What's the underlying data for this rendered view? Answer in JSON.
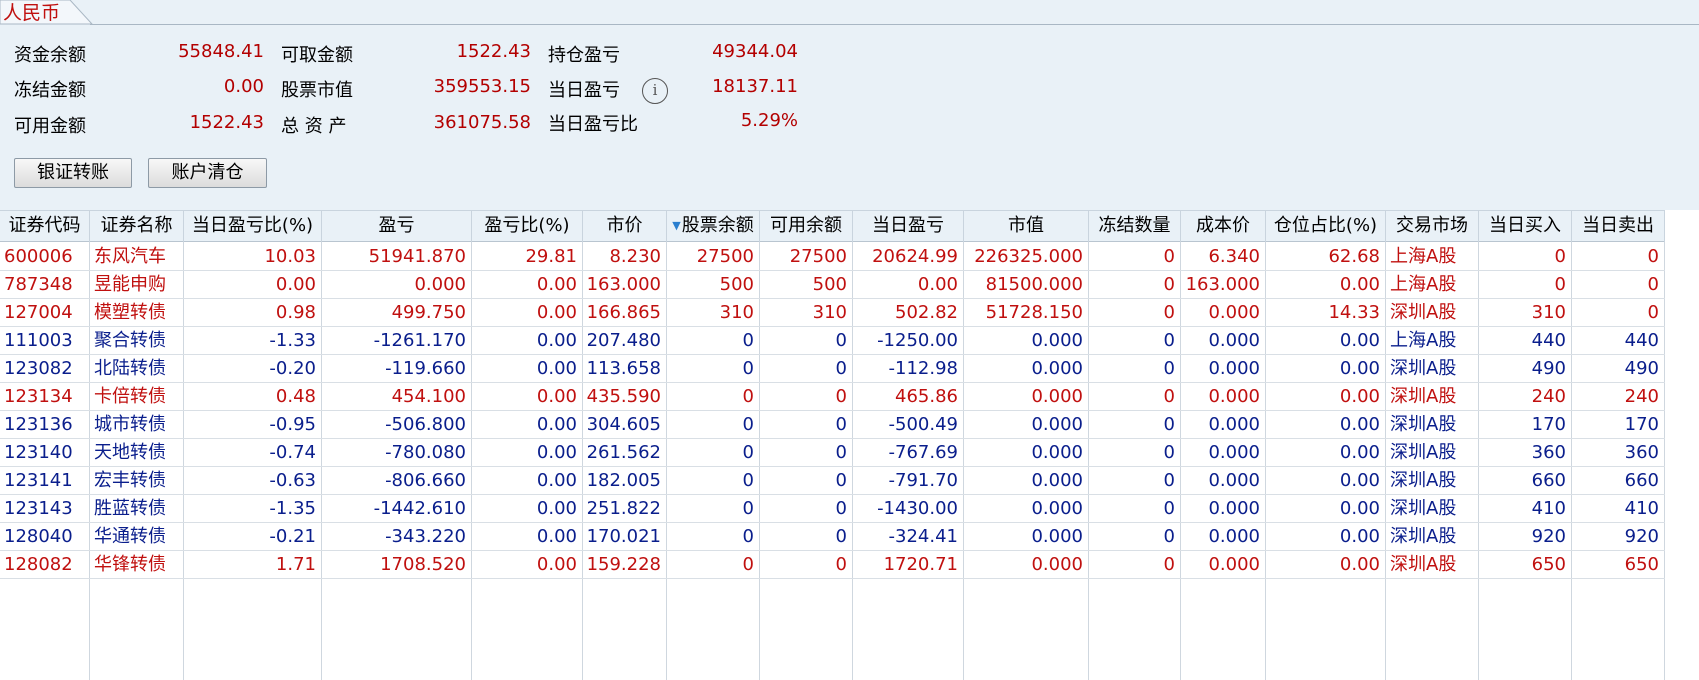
{
  "tab": {
    "label": "人民币"
  },
  "summary": {
    "fund_balance_label": "资金余额",
    "fund_balance": "55848.41",
    "withdrawable_label": "可取金额",
    "withdrawable": "1522.43",
    "position_pnl_label": "持仓盈亏",
    "position_pnl": "49344.04",
    "frozen_label": "冻结金额",
    "frozen": "0.00",
    "stock_value_label": "股票市值",
    "stock_value": "359553.15",
    "today_pnl_label": "当日盈亏",
    "today_pnl": "18137.11",
    "available_label": "可用金额",
    "available": "1522.43",
    "total_assets_label": "总 资 产",
    "total_assets": "361075.58",
    "today_pnl_ratio_label": "当日盈亏比",
    "today_pnl_ratio": "5.29%"
  },
  "buttons": {
    "bank_transfer": "银证转账",
    "clear_account": "账户清仓"
  },
  "colors": {
    "red": "#c0100f",
    "blue": "#0a1e8c"
  },
  "table": {
    "columns": [
      "证券代码",
      "证券名称",
      "当日盈亏比(%)",
      "盈亏",
      "盈亏比(%)",
      "市价",
      "股票余额",
      "可用余额",
      "当日盈亏",
      "市值",
      "冻结数量",
      "成本价",
      "仓位占比(%)",
      "交易市场",
      "当日买入",
      "当日卖出"
    ],
    "rows": [
      {
        "color": "red",
        "cells": [
          "600006",
          "东风汽车",
          "10.03",
          "51941.870",
          "29.81",
          "8.230",
          "27500",
          "27500",
          "20624.99",
          "226325.000",
          "0",
          "6.340",
          "62.68",
          "上海A股",
          "0",
          "0"
        ]
      },
      {
        "color": "red",
        "cells": [
          "787348",
          "昱能申购",
          "0.00",
          "0.000",
          "0.00",
          "163.000",
          "500",
          "500",
          "0.00",
          "81500.000",
          "0",
          "163.000",
          "0.00",
          "上海A股",
          "0",
          "0"
        ]
      },
      {
        "color": "red",
        "cells": [
          "127004",
          "模塑转债",
          "0.98",
          "499.750",
          "0.00",
          "166.865",
          "310",
          "310",
          "502.82",
          "51728.150",
          "0",
          "0.000",
          "14.33",
          "深圳A股",
          "310",
          "0"
        ]
      },
      {
        "color": "blue",
        "cells": [
          "111003",
          "聚合转债",
          "-1.33",
          "-1261.170",
          "0.00",
          "207.480",
          "0",
          "0",
          "-1250.00",
          "0.000",
          "0",
          "0.000",
          "0.00",
          "上海A股",
          "440",
          "440"
        ]
      },
      {
        "color": "blue",
        "cells": [
          "123082",
          "北陆转债",
          "-0.20",
          "-119.660",
          "0.00",
          "113.658",
          "0",
          "0",
          "-112.98",
          "0.000",
          "0",
          "0.000",
          "0.00",
          "深圳A股",
          "490",
          "490"
        ]
      },
      {
        "color": "red",
        "cells": [
          "123134",
          "卡倍转债",
          "0.48",
          "454.100",
          "0.00",
          "435.590",
          "0",
          "0",
          "465.86",
          "0.000",
          "0",
          "0.000",
          "0.00",
          "深圳A股",
          "240",
          "240"
        ]
      },
      {
        "color": "blue",
        "cells": [
          "123136",
          "城市转债",
          "-0.95",
          "-506.800",
          "0.00",
          "304.605",
          "0",
          "0",
          "-500.49",
          "0.000",
          "0",
          "0.000",
          "0.00",
          "深圳A股",
          "170",
          "170"
        ]
      },
      {
        "color": "blue",
        "cells": [
          "123140",
          "天地转债",
          "-0.74",
          "-780.080",
          "0.00",
          "261.562",
          "0",
          "0",
          "-767.69",
          "0.000",
          "0",
          "0.000",
          "0.00",
          "深圳A股",
          "360",
          "360"
        ]
      },
      {
        "color": "blue",
        "cells": [
          "123141",
          "宏丰转债",
          "-0.63",
          "-806.660",
          "0.00",
          "182.005",
          "0",
          "0",
          "-791.70",
          "0.000",
          "0",
          "0.000",
          "0.00",
          "深圳A股",
          "660",
          "660"
        ]
      },
      {
        "color": "blue",
        "cells": [
          "123143",
          "胜蓝转债",
          "-1.35",
          "-1442.610",
          "0.00",
          "251.822",
          "0",
          "0",
          "-1430.00",
          "0.000",
          "0",
          "0.000",
          "0.00",
          "深圳A股",
          "410",
          "410"
        ]
      },
      {
        "color": "blue",
        "cells": [
          "128040",
          "华通转债",
          "-0.21",
          "-343.220",
          "0.00",
          "170.021",
          "0",
          "0",
          "-324.41",
          "0.000",
          "0",
          "0.000",
          "0.00",
          "深圳A股",
          "920",
          "920"
        ]
      },
      {
        "color": "red",
        "cells": [
          "128082",
          "华锋转债",
          "1.71",
          "1708.520",
          "0.00",
          "159.228",
          "0",
          "0",
          "1720.71",
          "0.000",
          "0",
          "0.000",
          "0.00",
          "深圳A股",
          "650",
          "650"
        ]
      }
    ]
  }
}
